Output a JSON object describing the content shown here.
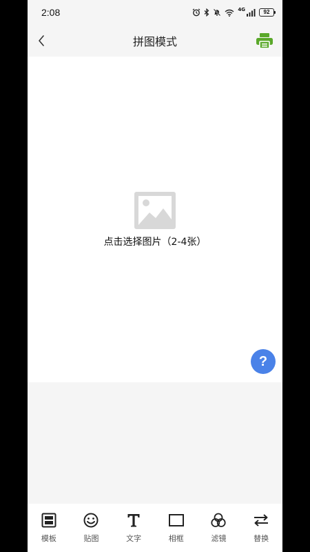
{
  "status_bar": {
    "time": "2:08",
    "network": "4G",
    "battery": "92"
  },
  "header": {
    "title": "拼图模式",
    "back_icon": "chevron-left-icon",
    "print_icon": "printer-icon",
    "print_color": "#5aa82a"
  },
  "canvas": {
    "placeholder_icon": "image-placeholder-icon",
    "placeholder_text": "点击选择图片（2-4张）"
  },
  "help": {
    "label": "?",
    "color": "#4a82e8"
  },
  "toolbar": {
    "items": [
      {
        "label": "模板",
        "icon": "template-icon"
      },
      {
        "label": "贴图",
        "icon": "sticker-icon"
      },
      {
        "label": "文字",
        "icon": "text-icon"
      },
      {
        "label": "相框",
        "icon": "frame-icon"
      },
      {
        "label": "滤镜",
        "icon": "filter-icon"
      },
      {
        "label": "替换",
        "icon": "replace-icon"
      }
    ]
  }
}
